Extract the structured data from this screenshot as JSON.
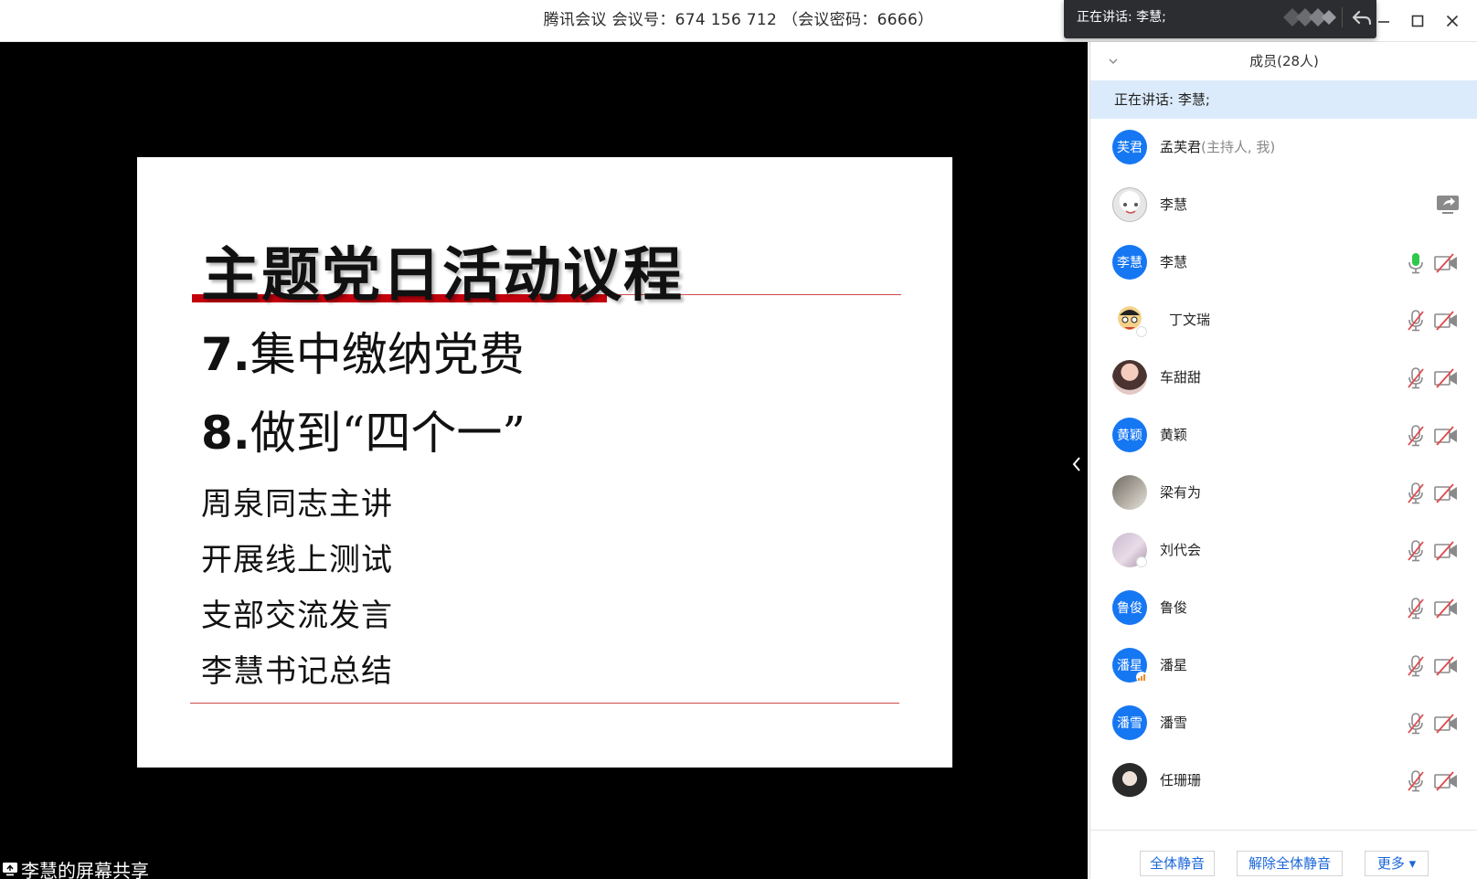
{
  "titlebar": {
    "title": "腾讯会议 会议号：674 156 712 （会议密码：6666）",
    "speaking_popup": "正在讲话: 李慧;"
  },
  "share": {
    "label": "李慧的屏幕共享",
    "slide": {
      "title": "主题党日活动议程",
      "item7_num": "7.",
      "item7_text": "集中缴纳党费",
      "item8_num": "8.",
      "item8_text": "做到“四个一”",
      "sub_items": [
        "周泉同志主讲",
        "开展线上测试",
        "支部交流发言",
        "李慧书记总结"
      ]
    }
  },
  "panel": {
    "title": "成员(28人)",
    "speaking": "正在讲话: 李慧;",
    "members": [
      {
        "name": "孟芙君",
        "role": "(主持人, 我)",
        "avatar_text": "芙君",
        "mic": "none",
        "cam": "none"
      },
      {
        "name": "李慧",
        "role": "",
        "avatar_text": "",
        "mic": "none",
        "cam": "share"
      },
      {
        "name": "李慧",
        "role": "",
        "avatar_text": "李慧",
        "mic": "active",
        "cam": "off"
      },
      {
        "name": "丁文瑞",
        "role": "",
        "avatar_text": "",
        "mic": "muted",
        "cam": "off"
      },
      {
        "name": "车甜甜",
        "role": "",
        "avatar_text": "",
        "mic": "muted",
        "cam": "off"
      },
      {
        "name": "黄颖",
        "role": "",
        "avatar_text": "黄颖",
        "mic": "muted",
        "cam": "off"
      },
      {
        "name": "梁有为",
        "role": "",
        "avatar_text": "",
        "mic": "muted",
        "cam": "off"
      },
      {
        "name": "刘代会",
        "role": "",
        "avatar_text": "",
        "mic": "muted",
        "cam": "off"
      },
      {
        "name": "鲁俊",
        "role": "",
        "avatar_text": "鲁俊",
        "mic": "muted",
        "cam": "off"
      },
      {
        "name": "潘星",
        "role": "",
        "avatar_text": "潘星",
        "mic": "muted",
        "cam": "off"
      },
      {
        "name": "潘雪",
        "role": "",
        "avatar_text": "潘雪",
        "mic": "muted",
        "cam": "off"
      },
      {
        "name": "任珊珊",
        "role": "",
        "avatar_text": "",
        "mic": "muted",
        "cam": "off"
      }
    ],
    "footer": {
      "mute_all": "全体静音",
      "unmute_all": "解除全体静音",
      "more": "更多 ▾"
    }
  },
  "colors": {
    "accent": "#1677f3",
    "slide_red": "#c4000d",
    "speaking_bg": "#dcebfb",
    "mic_active": "#2ec84a"
  },
  "icons": [
    "chevron-left-icon",
    "chevron-down-icon",
    "reply-icon",
    "minimize-icon",
    "maximize-icon",
    "close-icon",
    "mic-muted-icon",
    "mic-active-icon",
    "camera-off-icon",
    "screen-share-icon"
  ]
}
